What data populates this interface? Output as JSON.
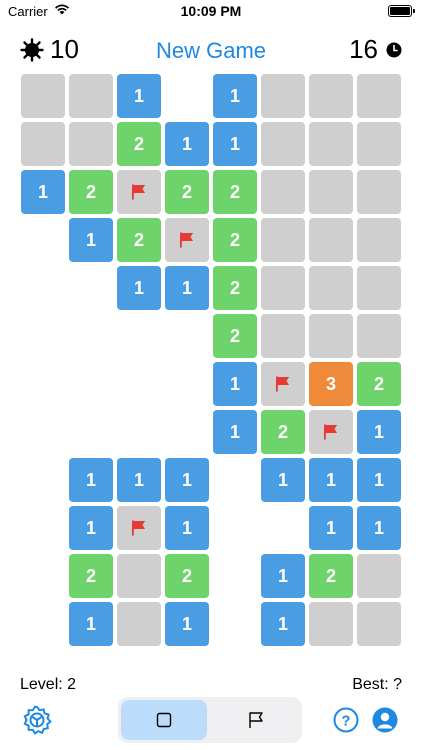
{
  "status_bar": {
    "carrier": "Carrier",
    "time": "10:09 PM"
  },
  "header": {
    "mine_count": "10",
    "new_game_label": "New Game",
    "timer": "16"
  },
  "board": {
    "rows": 12,
    "cols": 8,
    "cells": [
      [
        "hidden",
        "hidden",
        "1",
        "empty",
        "1",
        "hidden",
        "hidden",
        "hidden"
      ],
      [
        "hidden",
        "hidden",
        "2",
        "1",
        "1",
        "hidden",
        "hidden",
        "hidden"
      ],
      [
        "1",
        "2",
        "flag",
        "2",
        "2",
        "hidden",
        "hidden",
        "hidden"
      ],
      [
        "empty",
        "1",
        "2",
        "flag",
        "2",
        "hidden",
        "hidden",
        "hidden"
      ],
      [
        "empty",
        "empty",
        "1",
        "1",
        "2",
        "hidden",
        "hidden",
        "hidden"
      ],
      [
        "empty",
        "empty",
        "empty",
        "empty",
        "2",
        "hidden",
        "hidden",
        "hidden"
      ],
      [
        "empty",
        "empty",
        "empty",
        "empty",
        "1",
        "flag",
        "3",
        "2"
      ],
      [
        "empty",
        "empty",
        "empty",
        "empty",
        "1",
        "2",
        "flag",
        "1"
      ],
      [
        "empty",
        "1",
        "1",
        "1",
        "empty",
        "1",
        "1",
        "1"
      ],
      [
        "empty",
        "1",
        "flag",
        "1",
        "empty",
        "empty",
        "1",
        "1"
      ],
      [
        "empty",
        "2",
        "hidden",
        "2",
        "empty",
        "1",
        "2",
        "hidden"
      ],
      [
        "empty",
        "1",
        "hidden",
        "1",
        "empty",
        "1",
        "hidden",
        "hidden"
      ]
    ],
    "colors": {
      "1": "#4a9ce3",
      "2": "#6dd36a",
      "3": "#ef8a3a",
      "hidden": "#cfcfcf",
      "flag": "#e53935"
    }
  },
  "footer": {
    "level": "Level: 2",
    "best": "Best: ?"
  },
  "bottom_bar": {
    "icons": [
      "settings-icon",
      "reveal-mode-icon",
      "flag-mode-icon",
      "help-icon",
      "profile-icon"
    ],
    "accent": "#1e88e5"
  }
}
